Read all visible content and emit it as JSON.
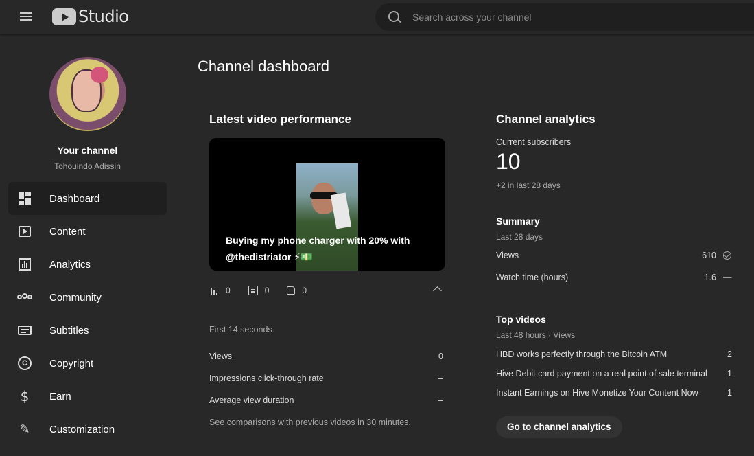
{
  "header": {
    "logo_text": "Studio",
    "search_placeholder": "Search across your channel"
  },
  "sidebar": {
    "your_channel": "Your channel",
    "owner": "Tohouindo Adissin",
    "items": [
      {
        "label": "Dashboard",
        "icon": "dashboard-icon",
        "active": true
      },
      {
        "label": "Content",
        "icon": "content-icon"
      },
      {
        "label": "Analytics",
        "icon": "analytics-icon"
      },
      {
        "label": "Community",
        "icon": "community-icon"
      },
      {
        "label": "Subtitles",
        "icon": "subtitles-icon"
      },
      {
        "label": "Copyright",
        "icon": "copyright-icon"
      },
      {
        "label": "Earn",
        "icon": "earn-icon"
      },
      {
        "label": "Customization",
        "icon": "customization-icon"
      }
    ]
  },
  "main": {
    "page_title": "Channel dashboard",
    "latest": {
      "title": "Latest video performance",
      "video_title": "Buying my phone charger with 20% with @thedistriator ⚡💵",
      "views_count": "0",
      "comments_count": "0",
      "likes_count": "0",
      "period": "First 14 seconds",
      "metrics": [
        {
          "label": "Views",
          "value": "0"
        },
        {
          "label": "Impressions click-through rate",
          "value": "–"
        },
        {
          "label": "Average view duration",
          "value": "–"
        }
      ],
      "note": "See comparisons with previous videos in 30 minutes."
    },
    "analytics": {
      "title": "Channel analytics",
      "subs_label": "Current subscribers",
      "subs_value": "10",
      "subs_change": "+2 in last 28 days",
      "summary_title": "Summary",
      "summary_period": "Last 28 days",
      "summary": [
        {
          "label": "Views",
          "value": "610",
          "indicator": "check"
        },
        {
          "label": "Watch time (hours)",
          "value": "1.6",
          "indicator": "—"
        }
      ],
      "top_title": "Top videos",
      "top_period": "Last 48 hours · Views",
      "top_videos": [
        {
          "title": "HBD works perfectly through the Bitcoin ATM",
          "views": "2"
        },
        {
          "title": "Hive Debit card payment on a real point of sale terminal",
          "views": "1"
        },
        {
          "title": "Instant Earnings on Hive Monetize Your Content Now",
          "views": "1"
        }
      ],
      "cta": "Go to channel analytics"
    }
  }
}
